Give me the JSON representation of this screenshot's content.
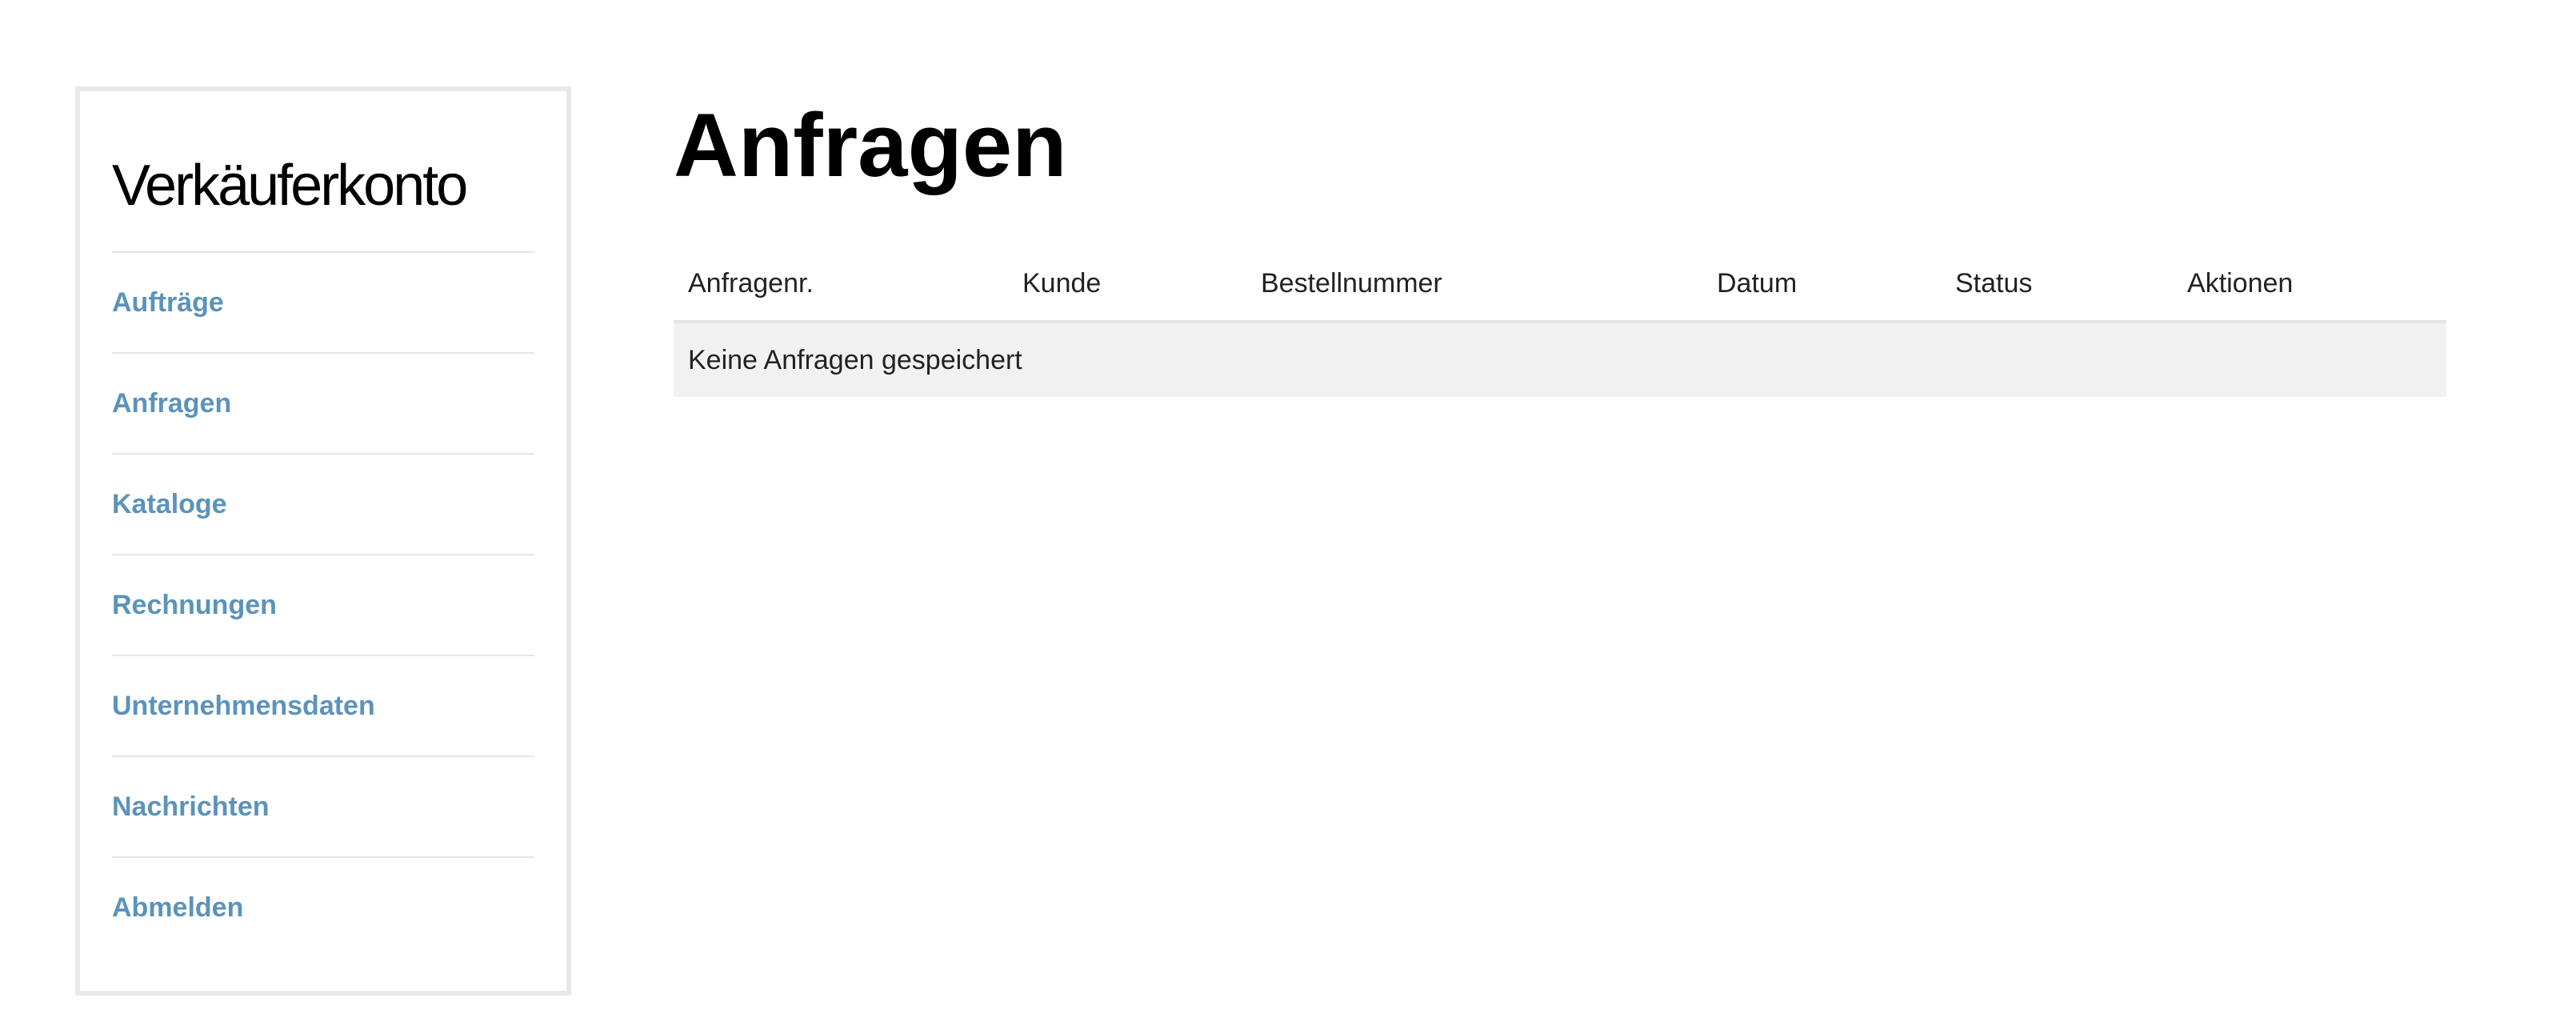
{
  "sidebar": {
    "title": "Verkäuferkonto",
    "items": [
      {
        "label": "Aufträge"
      },
      {
        "label": "Anfragen"
      },
      {
        "label": "Kataloge"
      },
      {
        "label": "Rechnungen"
      },
      {
        "label": "Unternehmensdaten"
      },
      {
        "label": "Nachrichten"
      },
      {
        "label": "Abmelden"
      }
    ]
  },
  "main": {
    "title": "Anfragen",
    "table": {
      "columns": [
        "Anfragenr.",
        "Kunde",
        "Bestellnummer",
        "Datum",
        "Status",
        "Aktionen"
      ],
      "empty_message": "Keine Anfragen gespeichert"
    }
  },
  "colors": {
    "link": "#5b93ba",
    "border": "#e9e9e9",
    "empty_row_bg": "#f1f1f1"
  }
}
